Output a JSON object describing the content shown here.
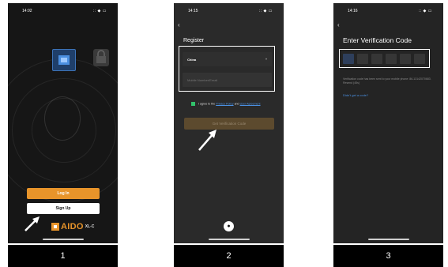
{
  "panels": [
    {
      "time": "14:02",
      "status_icons": "∷ ◆ ▭",
      "login_label": "Log In",
      "signup_label": "Sign Up",
      "brand_name": "AIDO",
      "brand_sub": "XL-C",
      "caption": "1"
    },
    {
      "time": "14:15",
      "status_icons": "∷ ◆ ▭",
      "title": "Register",
      "country_value": "China",
      "mobile_placeholder": "Mobile Number/Email",
      "agree_prefix": "I agree to the",
      "privacy_link": "Privacy Policy",
      "agree_and": "and",
      "user_agreement_link": "User Agreement",
      "get_code_label": "Get Verification Code",
      "caption": "2"
    },
    {
      "time": "14:16",
      "status_icons": "∷ ◆ ▭",
      "title": "Enter Verification Code",
      "description": "Verification code has been sent to your mobile phone: 86-13142070683. Resend (45s)",
      "resend_link": "Didn't get a code?",
      "caption": "3"
    }
  ],
  "colors": {
    "accent": "#e8942a",
    "link": "#4a90e2",
    "checkbox": "#32c26b"
  },
  "icons": {
    "back": "chevron-left-icon",
    "apple": "apple-icon",
    "arrow": "pointer-arrow-icon"
  }
}
